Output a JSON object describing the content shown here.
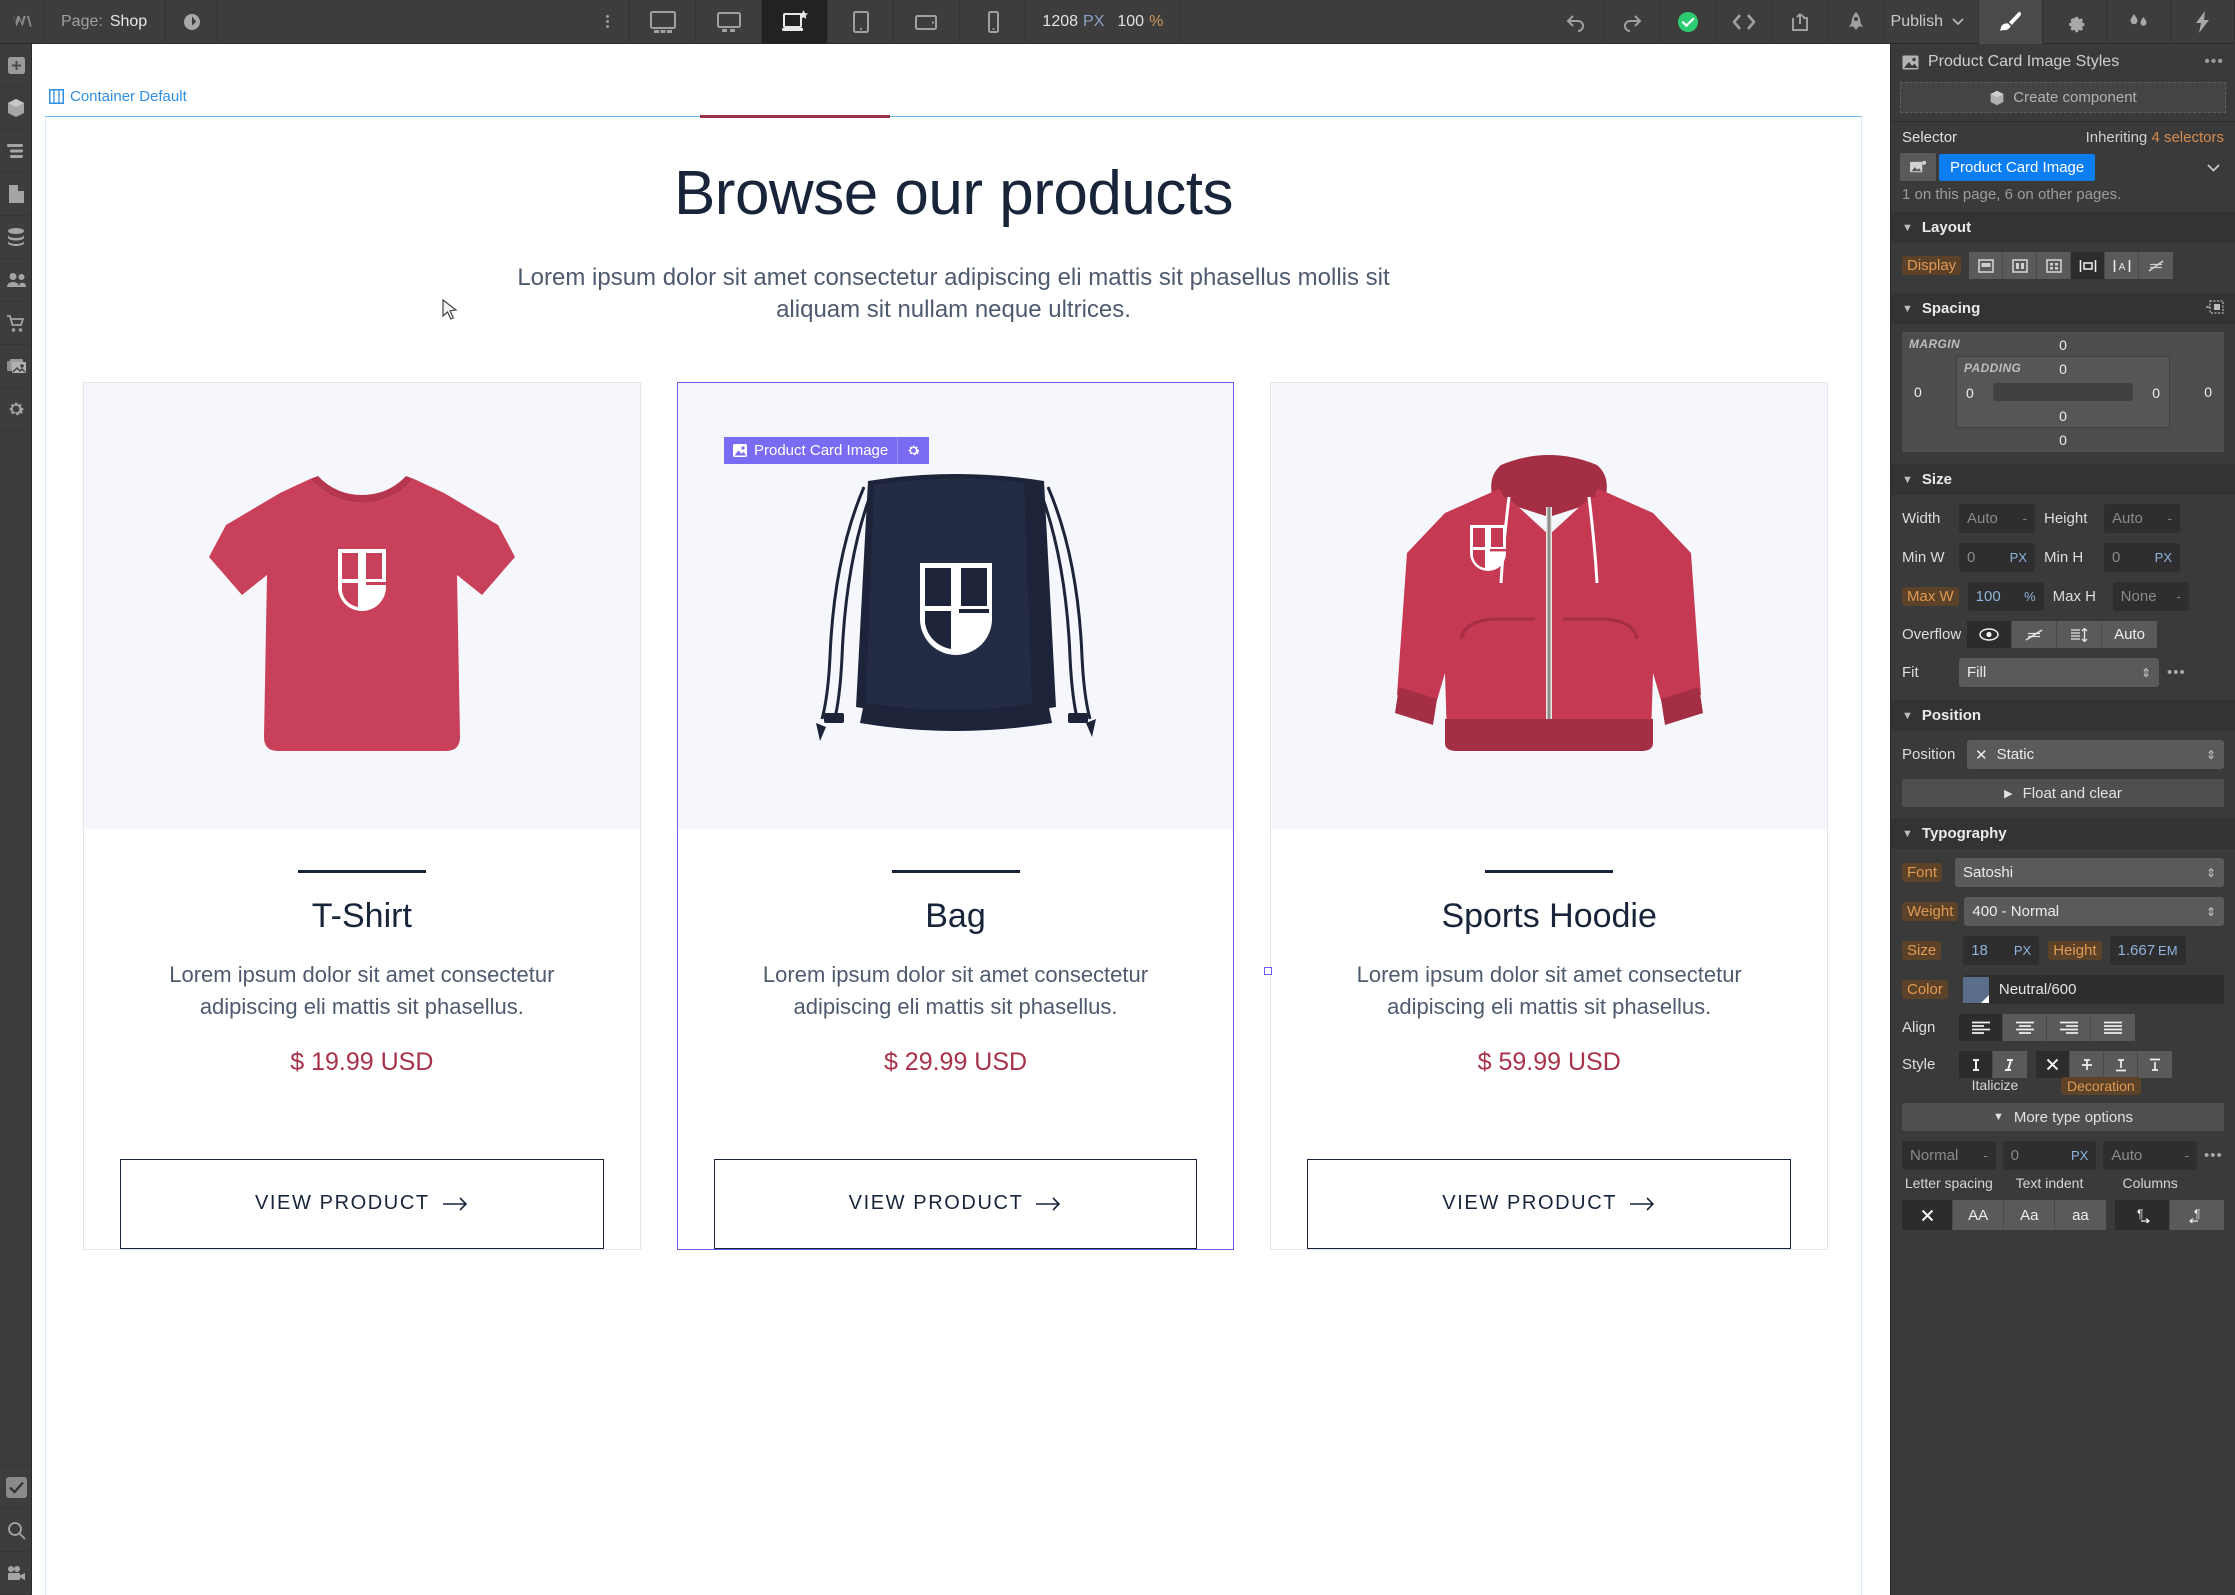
{
  "topbar": {
    "logo_icon": "webflow-logo-icon",
    "page_label": "Page:",
    "page_value": "Shop",
    "page_settings_icon": "page-settings-icon",
    "kebab_icon": "kebab-menu-icon",
    "breakpoints": [
      {
        "name": "breakpoint-desktop-xl",
        "icon": "monitor-large-icon",
        "active": false
      },
      {
        "name": "breakpoint-desktop",
        "icon": "monitor-icon",
        "active": false
      },
      {
        "name": "breakpoint-base",
        "icon": "laptop-star-icon",
        "active": true
      },
      {
        "name": "breakpoint-tablet",
        "icon": "tablet-portrait-icon",
        "active": false
      },
      {
        "name": "breakpoint-mobile-landscape",
        "icon": "tablet-landscape-icon",
        "active": false
      },
      {
        "name": "breakpoint-mobile-portrait",
        "icon": "phone-icon",
        "active": false
      }
    ],
    "canvas_width": "1208",
    "canvas_width_unit": "PX",
    "zoom_value": "100",
    "zoom_unit": "%",
    "undo_icon": "undo-icon",
    "redo_icon": "redo-icon",
    "status_icon": "checkmark-saved-icon",
    "code_icon": "code-export-icon",
    "share_icon": "share-icon",
    "rocket_icon": "rocket-icon",
    "publish_label": "Publish",
    "publish_caret_icon": "chevron-down-icon",
    "right_tabs": [
      {
        "name": "tab-style-panel",
        "icon": "paintbrush-icon",
        "active": true
      },
      {
        "name": "tab-settings-panel",
        "icon": "gear-icon",
        "active": false
      },
      {
        "name": "tab-interactions-panel",
        "icon": "droplets-icon",
        "active": false
      },
      {
        "name": "tab-effects-panel",
        "icon": "lightning-icon",
        "active": false
      }
    ]
  },
  "leftrail": {
    "items": [
      {
        "name": "rail-add-elements",
        "icon": "plus-square-icon",
        "selected": false
      },
      {
        "name": "rail-components",
        "icon": "cube-icon",
        "selected": false
      },
      {
        "name": "rail-navigator",
        "icon": "layers-list-icon",
        "selected": false
      },
      {
        "name": "rail-pages",
        "icon": "page-icon",
        "selected": false
      },
      {
        "name": "rail-cms",
        "icon": "database-icon",
        "selected": false
      },
      {
        "name": "rail-users",
        "icon": "users-icon",
        "selected": false
      },
      {
        "name": "rail-ecommerce",
        "icon": "shopping-cart-icon",
        "selected": false
      },
      {
        "name": "rail-assets",
        "icon": "images-icon",
        "selected": false
      },
      {
        "name": "rail-settings",
        "icon": "gear-icon",
        "selected": false
      }
    ],
    "bottom_items": [
      {
        "name": "rail-audit",
        "icon": "checkbox-check-icon",
        "selected": true
      },
      {
        "name": "rail-search",
        "icon": "magnifier-icon",
        "selected": false
      },
      {
        "name": "rail-video",
        "icon": "video-camera-icon",
        "selected": false
      }
    ]
  },
  "canvas": {
    "container_badge": {
      "icon": "container-icon",
      "label": "Container Default"
    },
    "selection_badge": {
      "icon": "image-icon",
      "label": "Product Card Image",
      "gear_icon": "gear-icon"
    },
    "cursor_icon": "mouse-pointer-icon",
    "hero": {
      "heading": "Browse our products",
      "subtext": "Lorem ipsum dolor sit amet consectetur adipiscing eli mattis sit phasellus mollis sit aliquam sit nullam neque ultrices."
    },
    "products": [
      {
        "name": "T-Shirt",
        "description": "Lorem ipsum dolor sit amet consectetur adipiscing eli mattis sit phasellus.",
        "price": "$ 19.99 USD",
        "cta": "VIEW PRODUCT",
        "cta_icon": "arrow-right-icon",
        "image_alt": "red-tshirt-image",
        "selected": false,
        "garment_color": "#c9405a",
        "bg_color": "#f5f7fc"
      },
      {
        "name": "Bag",
        "description": "Lorem ipsum dolor sit amet consectetur adipiscing eli mattis sit phasellus.",
        "price": "$ 29.99 USD",
        "cta": "VIEW PRODUCT",
        "cta_icon": "arrow-right-icon",
        "image_alt": "navy-drawstring-bag-image",
        "selected": true,
        "garment_color": "#1d2439",
        "bg_color": "#f5f7fc"
      },
      {
        "name": "Sports Hoodie",
        "description": "Lorem ipsum dolor sit amet consectetur adipiscing eli mattis sit phasellus.",
        "price": "$ 59.99 USD",
        "cta": "VIEW PRODUCT",
        "cta_icon": "arrow-right-icon",
        "image_alt": "red-zip-hoodie-image",
        "selected": false,
        "garment_color": "#c53a52",
        "bg_color": "#f8fafd"
      }
    ]
  },
  "style_panel": {
    "title": "Product Card Image Styles",
    "title_icon": "image-icon",
    "more_icon": "ellipsis-icon",
    "create_component_label": "Create component",
    "create_component_icon": "cube-icon",
    "selector_label": "Selector",
    "inheriting_label": "Inheriting",
    "inheriting_count": "4 selectors",
    "selector_tag": "Product Card Image",
    "selector_tag_icon": "image-element-icon",
    "selector_caret_icon": "chevron-down-icon",
    "selector_note": "1 on this page, 6 on other pages.",
    "layout": {
      "title": "Layout",
      "display_label": "Display",
      "display_options": [
        {
          "name": "display-block",
          "icon": "block-icon",
          "active": false
        },
        {
          "name": "display-flex",
          "icon": "flex-icon",
          "active": false
        },
        {
          "name": "display-grid",
          "icon": "grid-icon",
          "active": false
        },
        {
          "name": "display-inline-block",
          "icon": "inline-block-icon",
          "active": true
        },
        {
          "name": "display-inline",
          "icon": "inline-icon",
          "active": false
        },
        {
          "name": "display-none",
          "icon": "hidden-icon",
          "active": false
        }
      ]
    },
    "spacing": {
      "title": "Spacing",
      "tool_icon": "spacing-tool-icon",
      "margin_label": "MARGIN",
      "padding_label": "PADDING",
      "margin_top": "0",
      "margin_right": "0",
      "margin_bottom": "0",
      "margin_left": "0",
      "padding_top": "0",
      "padding_right": "0",
      "padding_bottom": "0",
      "padding_left": "0"
    },
    "size": {
      "title": "Size",
      "width_label": "Width",
      "width_value": "Auto",
      "width_unit": "-",
      "height_label": "Height",
      "height_value": "Auto",
      "height_unit": "-",
      "minw_label": "Min W",
      "minw_value": "0",
      "minw_unit": "PX",
      "minh_label": "Min H",
      "minh_value": "0",
      "minh_unit": "PX",
      "maxw_label": "Max W",
      "maxw_value": "100",
      "maxw_unit": "%",
      "maxh_label": "Max H",
      "maxh_value": "None",
      "maxh_unit": "-",
      "overflow_label": "Overflow",
      "overflow_options": [
        {
          "name": "overflow-visible",
          "icon": "eye-icon",
          "active": true
        },
        {
          "name": "overflow-hidden",
          "icon": "eye-off-icon",
          "active": false
        },
        {
          "name": "overflow-scroll",
          "icon": "scroll-icon",
          "active": false
        },
        {
          "name": "overflow-auto",
          "label": "Auto",
          "active": false
        }
      ],
      "fit_label": "Fit",
      "fit_value": "Fill",
      "fit_more_icon": "ellipsis-icon"
    },
    "position": {
      "title": "Position",
      "position_label": "Position",
      "position_clear_icon": "close-x-icon",
      "position_value": "Static",
      "float_label": "Float and clear",
      "float_caret_icon": "chevron-right-icon"
    },
    "typography": {
      "title": "Typography",
      "font_label": "Font",
      "font_value": "Satoshi",
      "weight_label": "Weight",
      "weight_value": "400 - Normal",
      "size_label": "Size",
      "size_value": "18",
      "size_unit": "PX",
      "lineheight_label": "Height",
      "lineheight_value": "1.667",
      "lineheight_unit": "EM",
      "color_label": "Color",
      "color_value": "Neutral/600",
      "color_hex": "#5a6e8c",
      "align_label": "Align",
      "align_options": [
        {
          "name": "align-left",
          "icon": "align-left-icon",
          "active": true
        },
        {
          "name": "align-center",
          "icon": "align-center-icon",
          "active": false
        },
        {
          "name": "align-right",
          "icon": "align-right-icon",
          "active": false
        },
        {
          "name": "align-justify",
          "icon": "align-justify-icon",
          "active": false
        }
      ],
      "style_label": "Style",
      "style_options": [
        {
          "name": "style-upright",
          "icon": "upright-I-icon",
          "active": true
        },
        {
          "name": "style-italic",
          "icon": "italic-I-icon",
          "active": false
        },
        {
          "name": "decoration-none",
          "icon": "close-x-icon",
          "active": true
        },
        {
          "name": "decoration-strikethrough",
          "icon": "strikethrough-icon",
          "active": false
        },
        {
          "name": "decoration-underline",
          "icon": "underline-icon",
          "active": false
        },
        {
          "name": "decoration-overline",
          "icon": "overline-icon",
          "active": false
        }
      ],
      "italicize_label": "Italicize",
      "decoration_label": "Decoration",
      "more_type_label": "More type options",
      "more_type_caret_icon": "chevron-down-icon",
      "letter_spacing_value": "Normal",
      "letter_spacing_unit": "-",
      "letter_spacing_label": "Letter spacing",
      "text_indent_value": "0",
      "text_indent_unit": "PX",
      "text_indent_label": "Text indent",
      "columns_value": "Auto",
      "columns_unit": "-",
      "columns_label": "Columns",
      "columns_more_icon": "ellipsis-icon",
      "transform_options": [
        {
          "name": "transform-none",
          "icon": "close-x-icon",
          "active": true
        },
        {
          "name": "transform-uppercase",
          "label": "AA",
          "active": false
        },
        {
          "name": "transform-capitalize",
          "label": "Aa",
          "active": false
        },
        {
          "name": "transform-lowercase",
          "label": "aa",
          "active": false
        }
      ],
      "direction_options": [
        {
          "name": "direction-ltr",
          "icon": "pilcrow-ltr-icon",
          "active": true
        },
        {
          "name": "direction-rtl",
          "icon": "pilcrow-rtl-icon",
          "active": false
        }
      ]
    }
  }
}
